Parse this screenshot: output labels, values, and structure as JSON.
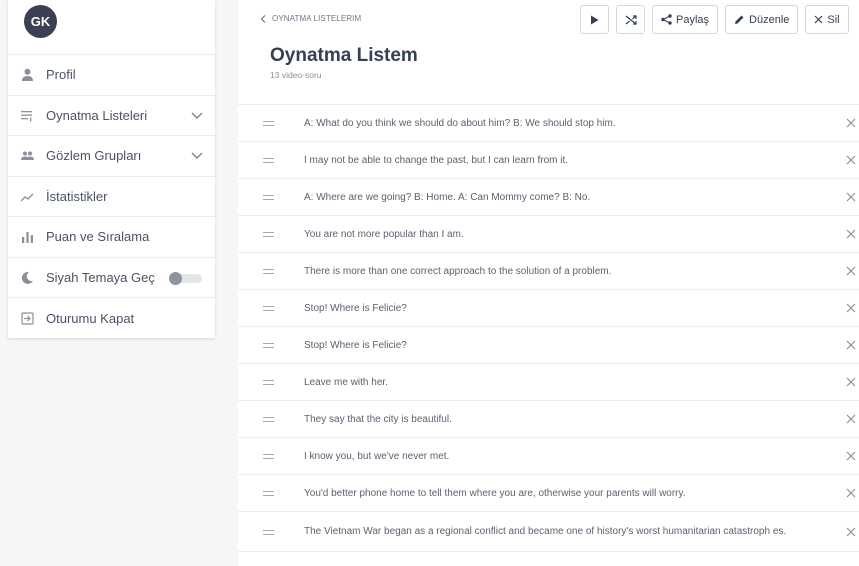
{
  "user": {
    "initials": "GK"
  },
  "sidebar": {
    "items": [
      {
        "label": "Profil",
        "icon": "user-icon"
      },
      {
        "label": "Oynatma Listeleri",
        "icon": "playlist-icon",
        "has_chevron": true
      },
      {
        "label": "Gözlem Grupları",
        "icon": "group-icon",
        "has_chevron": true
      },
      {
        "label": "İstatistikler",
        "icon": "chart-line-icon"
      },
      {
        "label": "Puan ve Sıralama",
        "icon": "bar-chart-icon"
      },
      {
        "label": "Siyah Temaya Geç",
        "icon": "moon-icon",
        "toggle": false
      },
      {
        "label": "Oturumu Kapat",
        "icon": "logout-icon"
      }
    ]
  },
  "header": {
    "breadcrumb": "OYNATMA LISTELERIM",
    "title": "Oynatma Listem",
    "subtitle": "13 video-soru"
  },
  "toolbar": {
    "share_label": "Paylaş",
    "edit_label": "Düzenle",
    "delete_label": "Sil"
  },
  "playlist": [
    "A: What do you think we should do about him? B: We should stop him.",
    "I may not be able to change the past, but I can learn from it.",
    "A: Where are we going? B: Home. A: Can Mommy come? B: No.",
    "You are not more popular than I am.",
    "There is more than one correct approach to the solution of a problem.",
    "Stop! Where is Felicie?",
    "Stop! Where is Felicie?",
    "Leave me with her.",
    "They say that the city is beautiful.",
    "I know you, but we've never met.",
    "You'd better phone home to tell them where you are, otherwise your parents will worry.",
    "The Vietnam War began as a regional conflict and became one of history's worst humanitarian catastroph es."
  ],
  "colors": {
    "accent": "#3b4152",
    "text": "#354052",
    "muted": "#8b909a"
  }
}
